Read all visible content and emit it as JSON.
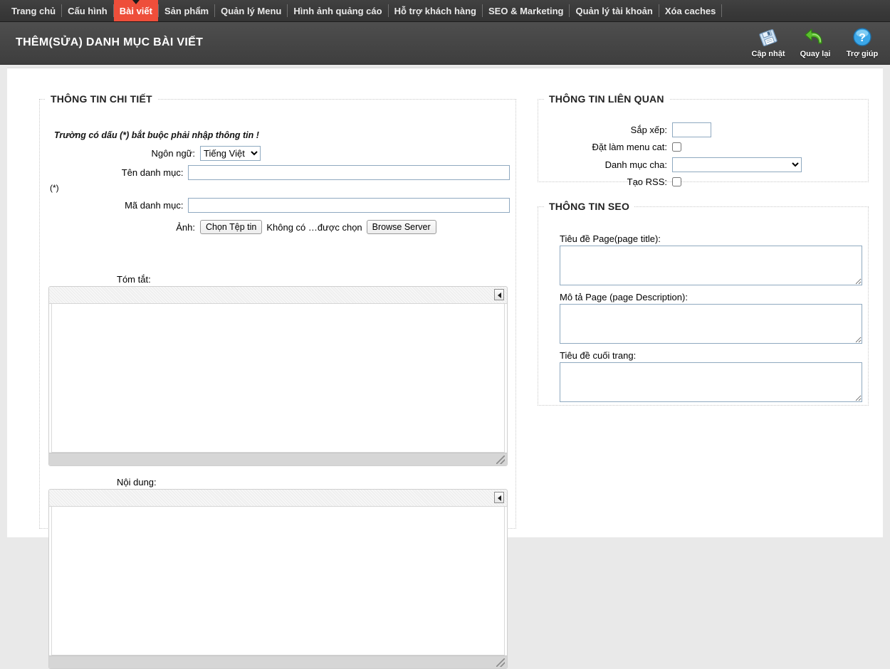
{
  "nav": {
    "items": [
      {
        "label": "Trang chủ",
        "active": false
      },
      {
        "label": "Cấu hình",
        "active": false
      },
      {
        "label": "Bài viết",
        "active": true
      },
      {
        "label": "Sản phẩm",
        "active": false
      },
      {
        "label": "Quản lý Menu",
        "active": false
      },
      {
        "label": "Hình ảnh quảng cáo",
        "active": false
      },
      {
        "label": "Hỗ trợ khách hàng",
        "active": false
      },
      {
        "label": "SEO & Marketing",
        "active": false
      },
      {
        "label": "Quản lý tài khoản",
        "active": false
      },
      {
        "label": "Xóa caches",
        "active": false
      }
    ]
  },
  "header": {
    "title": "THÊM(SỬA) DANH MỤC BÀI VIẾT",
    "tools": [
      {
        "label": "Cập nhật",
        "icon": "save-floppy-icon"
      },
      {
        "label": "Quay lại",
        "icon": "back-arrow-icon"
      },
      {
        "label": "Trợ giúp",
        "icon": "help-question-icon"
      }
    ]
  },
  "detail": {
    "legend": "THÔNG TIN CHI TIẾT",
    "note": "Trường có dấu (*) bắt buộc phải nhập thông tin !",
    "language_label": "Ngôn ngữ:",
    "language_value": "Tiếng Việt",
    "language_options": [
      "Tiếng Việt"
    ],
    "name_label": "Tên danh mục:",
    "name_value": "",
    "required_mark": "(*)",
    "code_label": "Mã danh mục:",
    "code_value": "",
    "image_label": "Ảnh:",
    "choose_file_button": "Chọn Tệp tin",
    "file_status": "Không có …được chọn",
    "browse_server_button": "Browse Server",
    "summary_label": "Tóm tắt:",
    "summary_value": "",
    "content_label": "Nội dung:",
    "content_value": ""
  },
  "related": {
    "legend": "THÔNG TIN LIÊN QUAN",
    "sort_label": "Sắp xếp:",
    "sort_value": "",
    "menu_cat_label": "Đặt làm menu cat:",
    "menu_cat_checked": false,
    "parent_label": "Danh mục cha:",
    "parent_value": "",
    "parent_options": [
      ""
    ],
    "rss_label": "Tạo RSS:",
    "rss_checked": false
  },
  "seo": {
    "legend": "THÔNG TIN SEO",
    "page_title_label": "Tiêu đề Page(page title):",
    "page_title_value": "",
    "page_desc_label": "Mô tả Page (page Description):",
    "page_desc_value": "",
    "footer_title_label": "Tiêu đề cuối trang:",
    "footer_title_value": ""
  },
  "colors": {
    "nav_bg": "#3b3b3b",
    "active_tab": "#ee4e3a",
    "header_bg": "#4a4a4a",
    "page_bg": "#e9e9e9",
    "input_border": "#8fa9c0"
  }
}
